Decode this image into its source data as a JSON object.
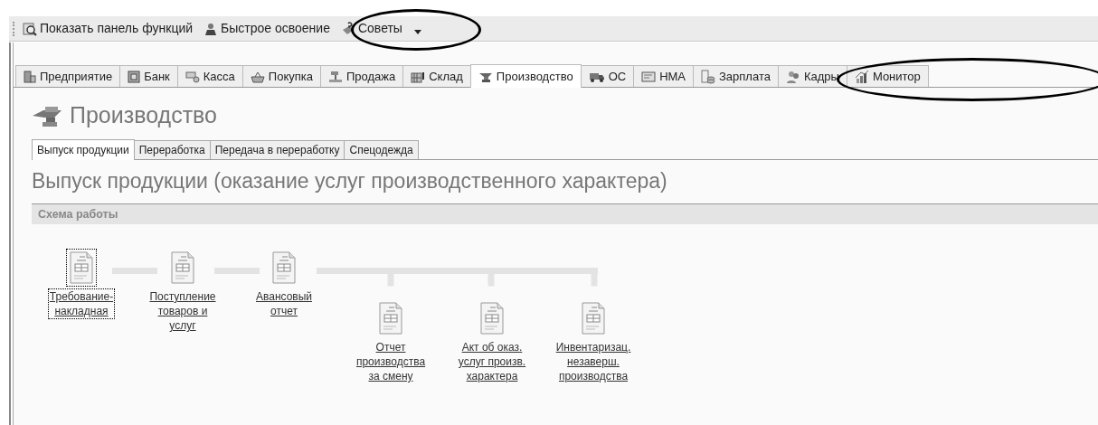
{
  "toolbar": {
    "items": [
      {
        "label": "Показать панель функций",
        "kind": "panel"
      },
      {
        "label": "Быстрое освоение",
        "kind": "learn"
      },
      {
        "label": "Советы",
        "kind": "tips",
        "dropdown": true
      }
    ]
  },
  "sections": [
    {
      "label": "Предприятие",
      "kind": "building",
      "selected": false
    },
    {
      "label": "Банк",
      "kind": "bank",
      "selected": false
    },
    {
      "label": "Касса",
      "kind": "cash",
      "selected": false
    },
    {
      "label": "Покупка",
      "kind": "basket",
      "selected": false
    },
    {
      "label": "Продажа",
      "kind": "scale",
      "selected": false
    },
    {
      "label": "Склад",
      "kind": "warehouse",
      "selected": false
    },
    {
      "label": "Производство",
      "kind": "anvil",
      "selected": true
    },
    {
      "label": "ОС",
      "kind": "truck",
      "selected": false
    },
    {
      "label": "НМА",
      "kind": "card",
      "selected": false
    },
    {
      "label": "Зарплата",
      "kind": "coins",
      "selected": false
    },
    {
      "label": "Кадры",
      "kind": "people",
      "selected": false
    },
    {
      "label": "Монитор",
      "kind": "chart",
      "selected": false
    }
  ],
  "page_title": "Производство",
  "subtabs": [
    {
      "label": "Выпуск продукции",
      "selected": true
    },
    {
      "label": "Переработка",
      "selected": false
    },
    {
      "label": "Передача в переработку",
      "selected": false
    },
    {
      "label": "Спецодежда",
      "selected": false
    }
  ],
  "heading": "Выпуск продукции (оказание услуг производственного характера)",
  "scheme": {
    "title": "Схема работы",
    "steps": [
      {
        "lines": [
          "Требование-",
          "накладная"
        ],
        "focused": true
      },
      {
        "lines": [
          "Поступление",
          "товаров и",
          "услуг"
        ],
        "focused": false
      },
      {
        "lines": [
          "Авансовый",
          "отчет"
        ],
        "focused": false
      }
    ],
    "branches": [
      {
        "lines": [
          "Отчет",
          "производства",
          "за смену"
        ],
        "focused": false
      },
      {
        "lines": [
          "Акт об оказ.",
          "услуг произв.",
          "характера"
        ],
        "focused": false
      },
      {
        "lines": [
          "Инвентаризац.",
          "незаверш.",
          "производства"
        ],
        "focused": false
      }
    ]
  },
  "annotations": [
    {
      "kind": "ellipse"
    },
    {
      "kind": "ellipse"
    }
  ]
}
